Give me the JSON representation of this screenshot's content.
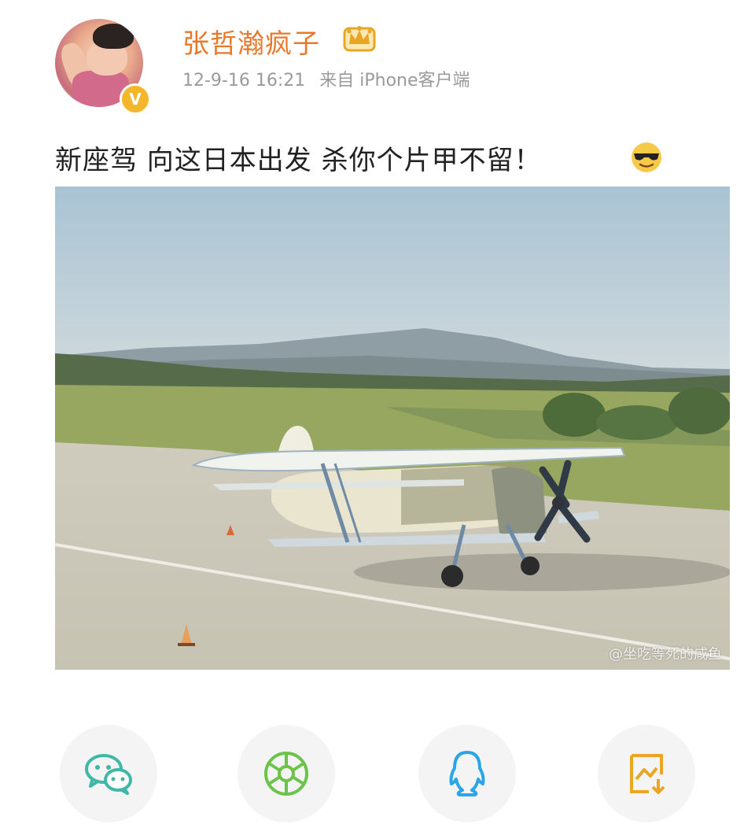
{
  "post": {
    "username": "张哲瀚疯子",
    "date": "12-9-16 16:21",
    "source": "来自 iPhone客户端",
    "text": "新座驾 向这日本出发 杀你个片甲不留！",
    "verified_badge": "V",
    "badge_icon": "crown-vip-icon",
    "emoji": "cool-sunglasses-emoji"
  },
  "image": {
    "watermark": "@坐吃等死的咸鱼",
    "subject": "biplane-on-runway"
  },
  "share": {
    "items": [
      {
        "icon": "wechat-icon",
        "color": "#3fb8a7"
      },
      {
        "icon": "moments-icon",
        "color": "#6cc34a"
      },
      {
        "icon": "qq-icon",
        "color": "#2aa6e8"
      },
      {
        "icon": "save-image-icon",
        "color": "#e8a623"
      }
    ]
  },
  "colors": {
    "username": "#e8782b",
    "meta": "#9a9a9a",
    "verified": "#f4b62a"
  }
}
